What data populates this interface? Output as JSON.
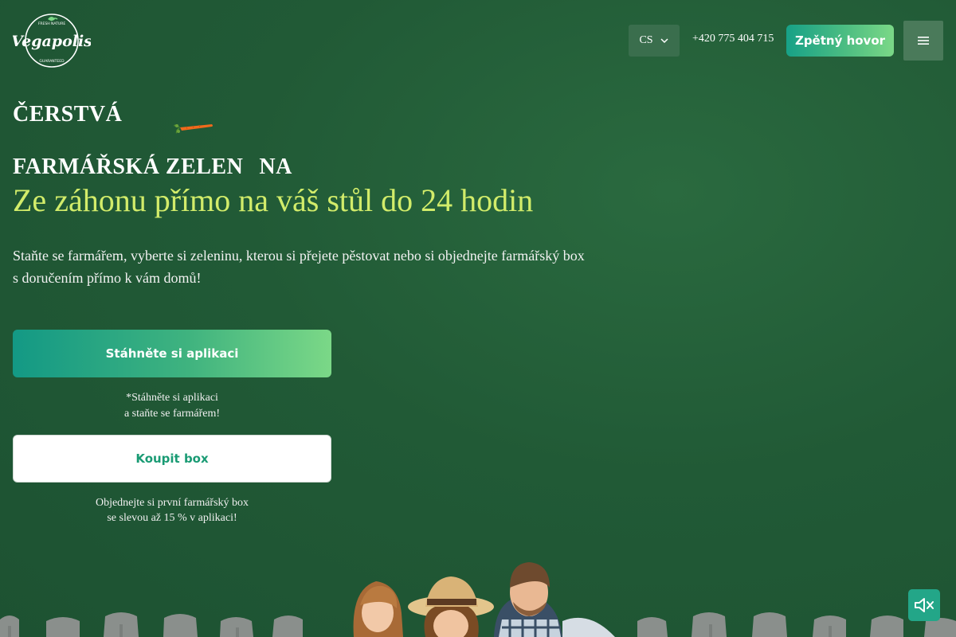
{
  "header": {
    "logo_text": "Vegapolis",
    "logo_ring_top": "FRESH NATURE",
    "logo_ring_bottom": "GUARANTEED",
    "language": "CS",
    "phone": "+420 775 404 715",
    "callback_label": "Zpětný hovor"
  },
  "hero": {
    "title_line1": "ČERSTVÁ",
    "title_line2_a": "FARMÁŘSKÁ ZELEN",
    "title_line2_b": "NA",
    "subtitle": "Ze záhonu přímo na váš stůl do 24 hodin",
    "lead_line1": "Staňte se farmářem, vyberte si zeleninu, kterou si přejete pěstovat nebo si objednejte farmářský box",
    "lead_line2": "s doručením přímo k vám domů!",
    "app_button": "Stáhněte si aplikaci",
    "app_note_line1": "*Stáhněte si aplikaci",
    "app_note_line2": "a staňte se farmářem!",
    "box_button": "Koupit box",
    "box_note_line1": "Objednejte si první farmářský box",
    "box_note_line2": "se slevou až 15 % v aplikaci!"
  },
  "colors": {
    "background": "#215a36",
    "accent_yellow": "#d2ec6a",
    "button_gradient_start": "#139985",
    "button_gradient_end": "#7bd887",
    "box_text": "#1a9b74"
  },
  "icons": {
    "language_dropdown": "chevron-down-icon",
    "menu": "hamburger-menu-icon",
    "sound": "volume-mute-icon",
    "decoration": "carrot-icon"
  }
}
